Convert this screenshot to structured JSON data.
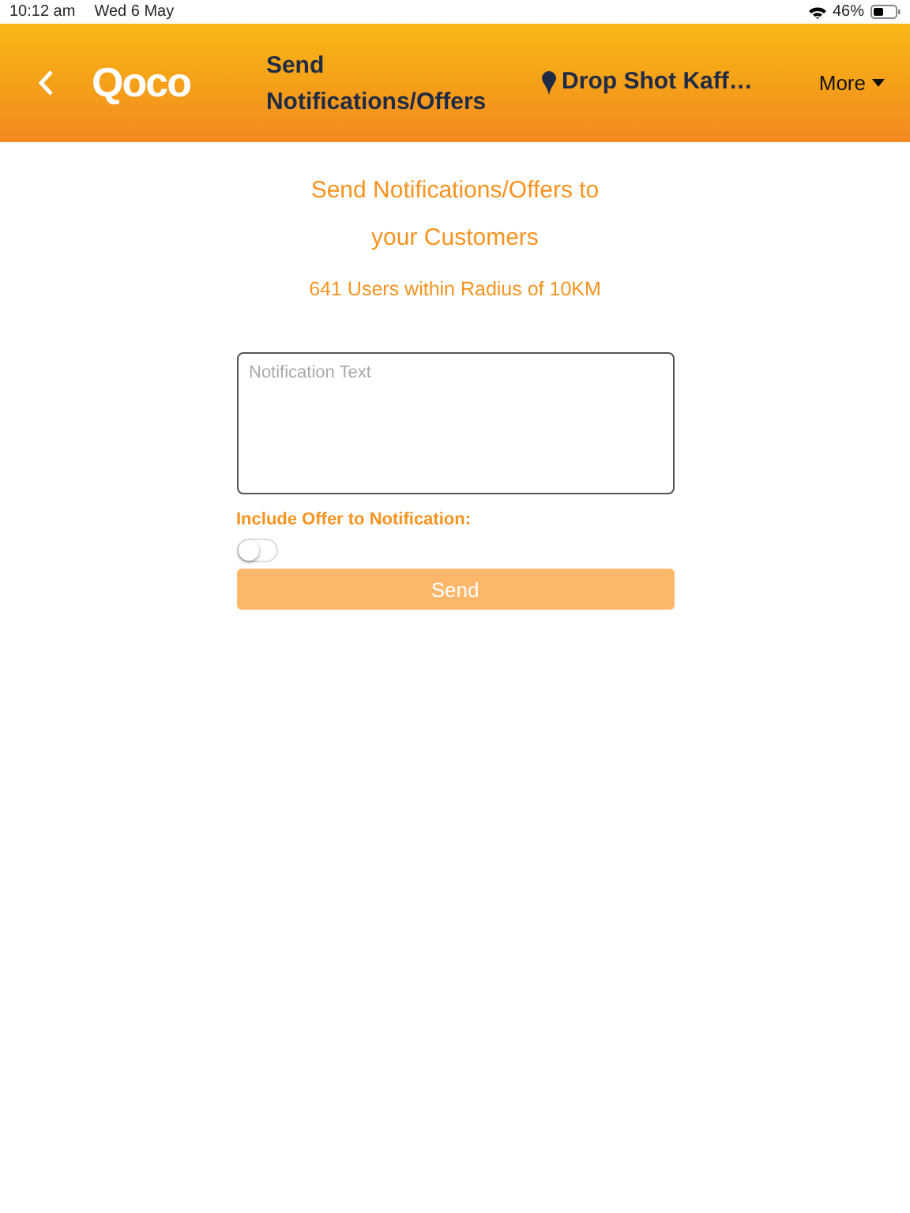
{
  "status_bar": {
    "time": "10:12 am",
    "date": "Wed 6 May",
    "battery": "46%"
  },
  "header": {
    "logo": "Qoco",
    "title_lines": [
      "Send",
      "Notifications/Offers"
    ],
    "location": "Drop Shot Kaff…",
    "more": "More"
  },
  "heading_lines": [
    "Send Notifications/Offers to",
    "your Customers"
  ],
  "subheading": "641 Users within Radius of 10KM",
  "notification_field": {
    "placeholder": "Notification Text"
  },
  "offer_toggle": {
    "label": "Include Offer to Notification:",
    "on": false
  },
  "send_button": {
    "label": "Send",
    "disabled": true
  }
}
